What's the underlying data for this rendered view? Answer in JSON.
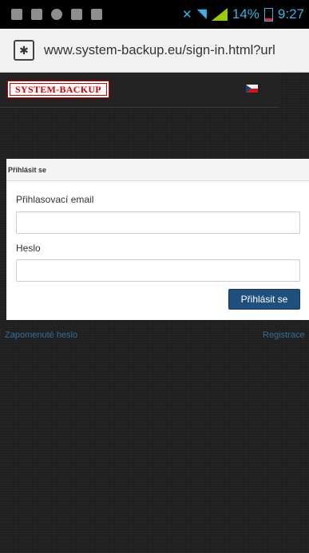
{
  "status_bar": {
    "battery": "14%",
    "time": "9:27"
  },
  "browser": {
    "url": "www.system-backup.eu/sign-in.html?url"
  },
  "site": {
    "logo_text": "SYSTEM-BACKUP"
  },
  "login": {
    "title": "Přihlásit se",
    "email_label": "Přihlasovací email",
    "email_value": "",
    "password_label": "Heslo",
    "password_value": "",
    "submit_label": "Přihlásit se"
  },
  "links": {
    "forgot_password": "Zapomenuté heslo",
    "register": "Registrace"
  },
  "colors": {
    "accent": "#33b5e5",
    "button": "#1f4f7c",
    "logo_red": "#cc0000",
    "link": "#2f6fa0"
  }
}
